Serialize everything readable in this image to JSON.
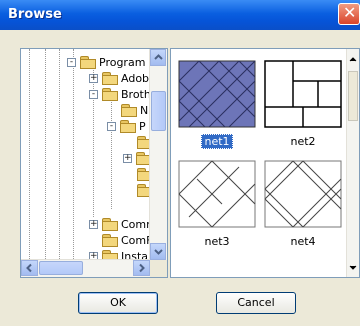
{
  "window": {
    "title": "Browse"
  },
  "tree": {
    "nodes": [
      {
        "label": "Program F",
        "expander": "-"
      },
      {
        "label": "Adob",
        "expander": "+"
      },
      {
        "label": "Broth",
        "expander": "-"
      },
      {
        "label": "N",
        "expander": ""
      },
      {
        "label": "P",
        "expander": "-"
      },
      {
        "label": "",
        "expander": ""
      },
      {
        "label": "",
        "expander": "+"
      },
      {
        "label": "",
        "expander": ""
      },
      {
        "label": "",
        "expander": ""
      },
      {
        "label": "Comn",
        "expander": "+"
      },
      {
        "label": "ComF",
        "expander": ""
      },
      {
        "label": "Instal",
        "expander": "+"
      }
    ]
  },
  "thumbnails": [
    {
      "label": "net1",
      "selected": true
    },
    {
      "label": "net2",
      "selected": false
    },
    {
      "label": "net3",
      "selected": false
    },
    {
      "label": "net4",
      "selected": false
    }
  ],
  "buttons": {
    "ok": "OK",
    "cancel": "Cancel"
  }
}
